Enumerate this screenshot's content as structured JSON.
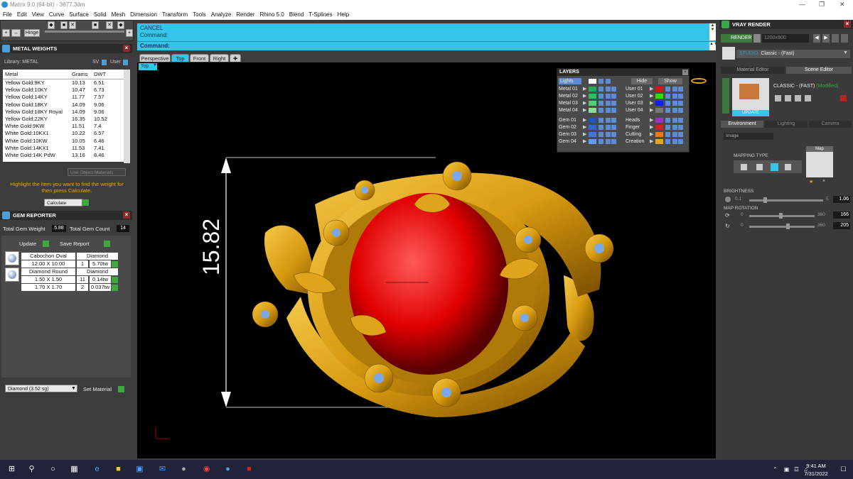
{
  "window": {
    "title": "Matrix 9.0 (64-bit) - 3677.3dm"
  },
  "menu": [
    "File",
    "Edit",
    "View",
    "Curve",
    "Surface",
    "Solid",
    "Mesh",
    "Dimension",
    "Transform",
    "Tools",
    "Analyze",
    "Render",
    "Rhino 5.0",
    "Blend",
    "T-Splines",
    "Help"
  ],
  "toolbar": {
    "hinge_label": "Hinge"
  },
  "metal_weights": {
    "title": "METAL WEIGHTS",
    "library_label": "Library: METAL",
    "sv_label": "SV",
    "user_label": "User",
    "columns": [
      "Metal",
      "Grams",
      "DWT"
    ],
    "rows": [
      [
        "Yellow Gold:9KY",
        "10.13",
        "6.51"
      ],
      [
        "Yellow Gold:10KY",
        "10.47",
        "6.73"
      ],
      [
        "Yellow Gold:14KY",
        "11.77",
        "7.57"
      ],
      [
        "Yellow Gold:18KY",
        "14.09",
        "9.06"
      ],
      [
        "Yellow Gold:18KY Royal",
        "14.09",
        "9.06"
      ],
      [
        "Yellow Gold:22KY",
        "16.35",
        "10.52"
      ],
      [
        "White Gold:9KW",
        "11.51",
        "7.4"
      ],
      [
        "White Gold:10KX1",
        "10.22",
        "6.57"
      ],
      [
        "White Gold:10KW",
        "10.05",
        "6.46"
      ],
      [
        "White Gold:14KX1",
        "11.53",
        "7.41"
      ],
      [
        "White Gold:14K PdW",
        "13.16",
        "8.46"
      ]
    ],
    "use_object_materials": "Use Object Materials",
    "instruction": "Highlight the item you want to find the weight for then press Calculate.",
    "calculate_label": "Calculate"
  },
  "gem_reporter": {
    "title": "GEM REPORTER",
    "total_weight_label": "Total Gem Weight",
    "total_weight_value": "5.88",
    "total_count_label": "Total Gem Count",
    "total_count_value": "14",
    "update_label": "Update",
    "save_report_label": "Save Report",
    "gems": [
      {
        "name": "Cabochon Oval",
        "type": "Diamond",
        "sizes": [
          [
            "12.00 X 10.00",
            "1",
            "5.70tw"
          ]
        ]
      },
      {
        "name": "Diamond Round",
        "type": "Diamond",
        "sizes": [
          [
            "1.50 X 1.50",
            "11",
            "0.14tw"
          ],
          [
            "1.70 X 1.70",
            "2",
            "0.037tw"
          ]
        ]
      }
    ],
    "material_select": "Diamond     (3.52 sg)",
    "set_material_label": "Set Material"
  },
  "command": {
    "line1": "CANCEL",
    "line2": "Command:",
    "prompt": "Command:"
  },
  "viewport_tabs": [
    "Perspective",
    "Top",
    "Front",
    "Right"
  ],
  "viewport": {
    "label": "Top",
    "dimension": "15.82",
    "gem_color": "#e00000",
    "metal_color": "#e0a41a"
  },
  "layers": {
    "title": "LAYERS",
    "lights_label": "Lights",
    "hide_label": "Hide",
    "show_label": "Show",
    "left": [
      {
        "name": "Metal 01",
        "color": "#22aa55"
      },
      {
        "name": "Metal 02",
        "color": "#33bb66"
      },
      {
        "name": "Metal 03",
        "color": "#55cc77"
      },
      {
        "name": "Metal 04",
        "color": "#88dd99"
      },
      {
        "name": "Gem 01",
        "color": "#2255bb"
      },
      {
        "name": "Gem 02",
        "color": "#3366cc"
      },
      {
        "name": "Gem 03",
        "color": "#4477dd"
      },
      {
        "name": "Gem 04",
        "color": "#6699ee"
      }
    ],
    "right": [
      {
        "name": "User 01",
        "color": "#dd1111"
      },
      {
        "name": "User 02",
        "color": "#22dd22"
      },
      {
        "name": "User 03",
        "color": "#1122dd"
      },
      {
        "name": "User 04",
        "color": "#777777"
      },
      {
        "name": "Heads",
        "color": "#9933cc"
      },
      {
        "name": "Finger",
        "color": "#cc2222"
      },
      {
        "name": "Cutting",
        "color": "#ee7711"
      },
      {
        "name": "Creation",
        "color": "#ddaa22"
      }
    ]
  },
  "vray": {
    "title": "VRAY RENDER",
    "render_label": "RENDER",
    "resolution": "1200x900",
    "preset_label": "STUDIO",
    "preset_value": "Classic - (Fast)",
    "tabs": [
      "Material Editor",
      "Scene Editor"
    ],
    "scene_name": "CLASSIC - (FAST)",
    "scene_modified": "(Modified)",
    "update_label": "UPDATE",
    "sub_tabs": [
      "Environment",
      "Lighting",
      "Camera"
    ],
    "env_select": "Image",
    "mapping_type_label": "MAPPING TYPE",
    "map_label": "Map",
    "brightness_label": "BRIGHTNESS",
    "brightness_min": "0.1",
    "brightness_max": "5",
    "brightness_value": "1.06",
    "map_rotation_label": "MAP ROTATION",
    "rot1_min": "0",
    "rot1_max": "360",
    "rot1_value": "166",
    "rot2_min": "0",
    "rot2_max": "360",
    "rot2_value": "205"
  },
  "taskbar": {
    "time": "9:41 AM",
    "date": "7/31/2022"
  }
}
